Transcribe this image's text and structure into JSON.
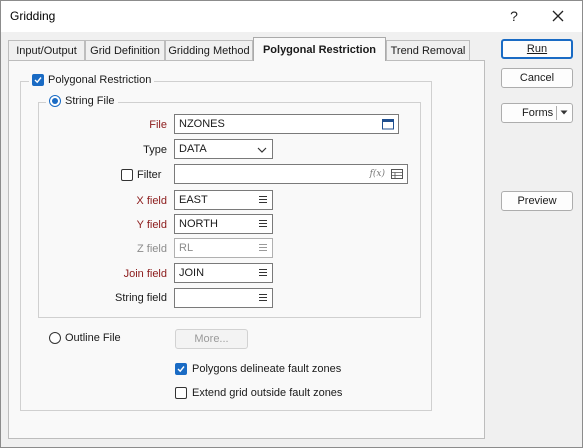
{
  "window": {
    "title": "Gridding",
    "help_glyph": "?"
  },
  "tabs": [
    {
      "label": "Input/Output"
    },
    {
      "label": "Grid Definition"
    },
    {
      "label": "Gridding Method"
    },
    {
      "label": "Polygonal Restriction"
    },
    {
      "label": "Trend Removal"
    }
  ],
  "active_tab": "Polygonal Restriction",
  "polygonal_restriction": {
    "label": "Polygonal Restriction",
    "checked": true,
    "string_file": {
      "label": "String File",
      "selected": true,
      "file": {
        "label": "File",
        "value": "NZONES"
      },
      "type": {
        "label": "Type",
        "value": "DATA"
      },
      "filter": {
        "label": "Filter",
        "checked": false,
        "value": "",
        "fx_glyph": "f(x)"
      },
      "x_field": {
        "label": "X field",
        "value": "EAST"
      },
      "y_field": {
        "label": "Y field",
        "value": "NORTH"
      },
      "z_field": {
        "label": "Z field",
        "value": "RL"
      },
      "join_field": {
        "label": "Join field",
        "value": "JOIN"
      },
      "string_field": {
        "label": "String field",
        "value": ""
      }
    },
    "outline_file": {
      "label": "Outline File",
      "selected": false,
      "more_button": "More..."
    },
    "polygons_fault_zones": {
      "label": "Polygons delineate fault zones",
      "checked": true
    },
    "extend_grid": {
      "label": "Extend grid outside fault zones",
      "checked": false
    }
  },
  "buttons": {
    "run": "Run",
    "cancel": "Cancel",
    "forms": "Forms",
    "preview": "Preview"
  },
  "colors": {
    "accent": "#1a6bc4",
    "required_label": "#8b1a1a",
    "disabled_text": "#8c8c8c"
  }
}
